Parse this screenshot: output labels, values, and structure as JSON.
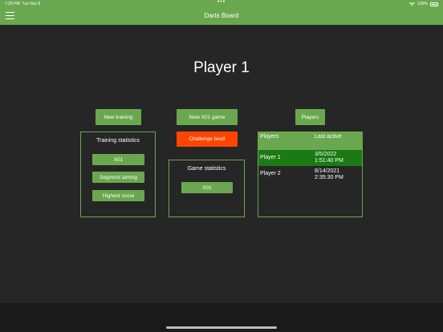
{
  "statusbar": {
    "time": "7:39 PM",
    "date": "Tue Nov 8",
    "dots": "•••",
    "battery": "100%"
  },
  "navbar": {
    "title": "Darts Board"
  },
  "page": {
    "title": "Player 1"
  },
  "training": {
    "new_label": "New training",
    "panel_title": "Training statistics",
    "buttons": [
      "X01",
      "Segment aiming",
      "Highest score"
    ]
  },
  "game": {
    "new_label": "New X01 game",
    "challenge_label": "Challenge best!",
    "panel_title": "Game statistics",
    "buttons": [
      "X01"
    ]
  },
  "players": {
    "button_label": "Players",
    "columns": [
      "Players",
      "Last active"
    ],
    "rows": [
      {
        "name": "Player 1",
        "date": "3/5/2022",
        "time": "1:51:40 PM",
        "selected": true
      },
      {
        "name": "Player 2",
        "date": "8/14/2021",
        "time": "2:35:30 PM",
        "selected": false
      }
    ]
  },
  "colors": {
    "accent": "#6aa84f",
    "challenge": "#ff4500",
    "selected_row": "#1a7a13",
    "background": "#262626"
  }
}
